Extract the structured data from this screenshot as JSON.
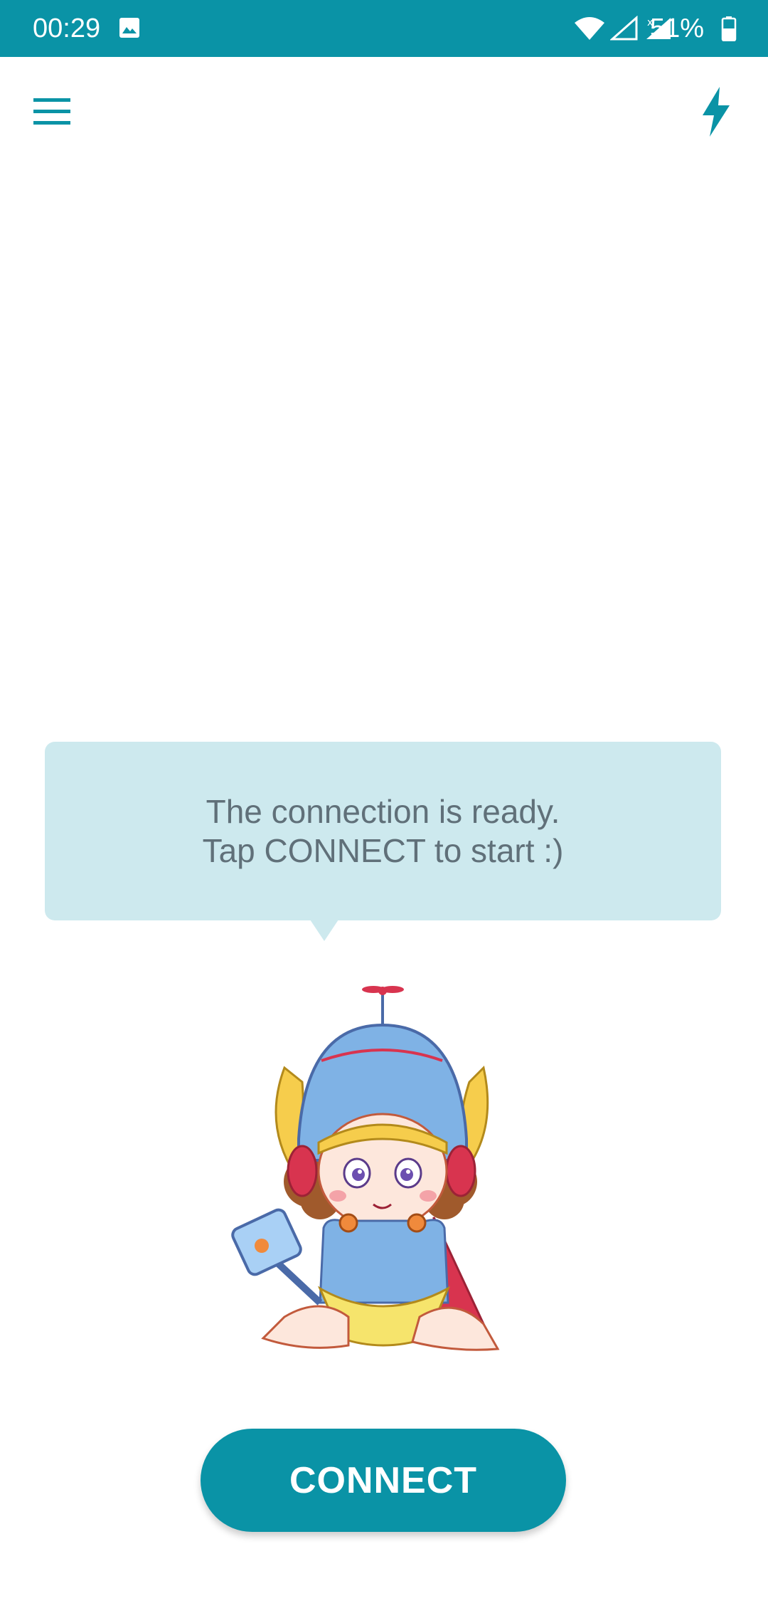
{
  "status_bar": {
    "time": "00:29",
    "battery": "51%",
    "color": "#0a93a6"
  },
  "app_bar": {
    "menu_icon": "hamburger-menu-icon",
    "action_icon": "lightning-bolt-icon",
    "accent": "#0a93a6"
  },
  "message": {
    "line1": "The connection is ready.",
    "line2": "Tap CONNECT to start :)",
    "bubble_color": "#cde9ee"
  },
  "connect_button": {
    "label": "CONNECT"
  }
}
